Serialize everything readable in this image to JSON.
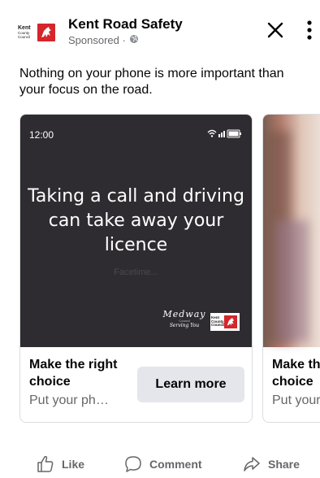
{
  "post": {
    "page_name": "Kent Road Safety",
    "sponsored_label": "Sponsored · ",
    "body_text": "Nothing on your phone is more important than your focus on the road.",
    "avatar_logo_text": "Kent County Council"
  },
  "carousel": {
    "cards": [
      {
        "media": {
          "time": "12:00",
          "headline": "Taking a call and driving can take away your licence",
          "faded_text": "Facetime...",
          "partner_logo": "Medway",
          "partner_sub": "Council",
          "partner_tagline": "Serving You",
          "council_logo_text": "Kent County Council"
        },
        "title": "Make the right choice",
        "description": "Put your ph…",
        "cta_label": "Learn more"
      },
      {
        "title": "Make the right choice",
        "description": "Put your ph…"
      }
    ]
  },
  "actions": {
    "like_label": "Like",
    "comment_label": "Comment",
    "share_label": "Share"
  },
  "icons": {
    "close": "close-icon",
    "more": "more-vertical-icon",
    "globe": "globe-icon",
    "like": "thumbs-up-icon",
    "comment": "comment-icon",
    "share": "share-icon"
  },
  "colors": {
    "text_primary": "#050505",
    "text_secondary": "#65676b",
    "button_bg": "#e4e6eb",
    "media_bg": "#2e2c31",
    "kent_red": "#d4262b"
  }
}
